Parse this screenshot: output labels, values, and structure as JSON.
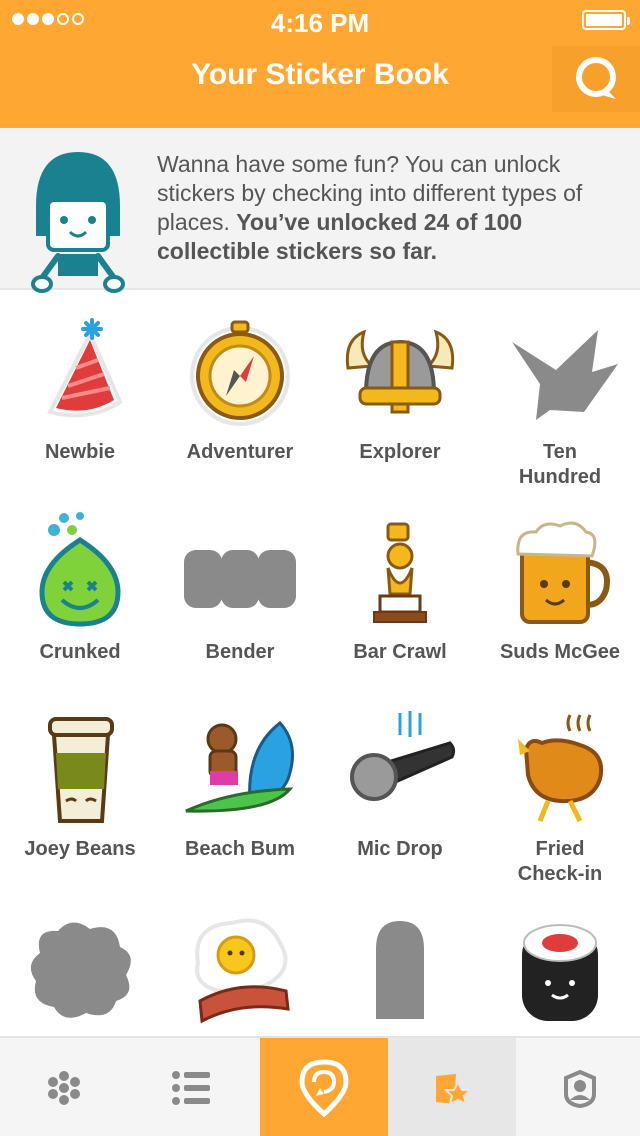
{
  "status_bar": {
    "time": "4:16 PM",
    "signal_dots": 5,
    "signal_filled": 3
  },
  "header": {
    "title": "Your Sticker Book",
    "search_icon": "search-bubble-icon"
  },
  "intro": {
    "text_plain": "Wanna have some fun? You can unlock stickers by checking into different types of places. ",
    "text_bold": "You’ve unlocked 24 of 100 collectible stickers so far."
  },
  "stickers": [
    {
      "label": "Newbie",
      "icon": "party-hat-icon",
      "unlocked": true
    },
    {
      "label": "Adventurer",
      "icon": "compass-icon",
      "unlocked": true
    },
    {
      "label": "Explorer",
      "icon": "viking-helmet-icon",
      "unlocked": true
    },
    {
      "label": "Ten Hundred",
      "icon": "paper-crane-icon",
      "unlocked": false
    },
    {
      "label": "Crunked",
      "icon": "green-drop-icon",
      "unlocked": true
    },
    {
      "label": "Bender",
      "icon": "barrels-icon",
      "unlocked": false
    },
    {
      "label": "Bar Crawl",
      "icon": "trophy-icon",
      "unlocked": true
    },
    {
      "label": "Suds McGee",
      "icon": "beer-mug-icon",
      "unlocked": true
    },
    {
      "label": "Joey Beans",
      "icon": "coffee-cup-icon",
      "unlocked": true
    },
    {
      "label": "Beach Bum",
      "icon": "surfing-bear-icon",
      "unlocked": true
    },
    {
      "label": "Mic Drop",
      "icon": "microphone-icon",
      "unlocked": true
    },
    {
      "label": "Fried Check-in",
      "icon": "fried-chicken-icon",
      "unlocked": true
    },
    {
      "label": "",
      "icon": "locked-blob-icon",
      "unlocked": false
    },
    {
      "label": "",
      "icon": "egg-bacon-icon",
      "unlocked": true
    },
    {
      "label": "",
      "icon": "locked-bullet-icon",
      "unlocked": false
    },
    {
      "label": "",
      "icon": "sushi-roll-icon",
      "unlocked": true
    }
  ],
  "tabbar": {
    "tabs": [
      {
        "icon": "dots-grid-icon"
      },
      {
        "icon": "list-icon"
      },
      {
        "icon": "check-in-pin-icon",
        "highlight": true
      },
      {
        "icon": "stickers-icon",
        "active": true
      },
      {
        "icon": "profile-icon"
      }
    ]
  },
  "colors": {
    "brand_orange": "#ffa633",
    "text_gray": "#555555",
    "locked_gray": "#8a8a8a",
    "teal": "#1a8190"
  }
}
